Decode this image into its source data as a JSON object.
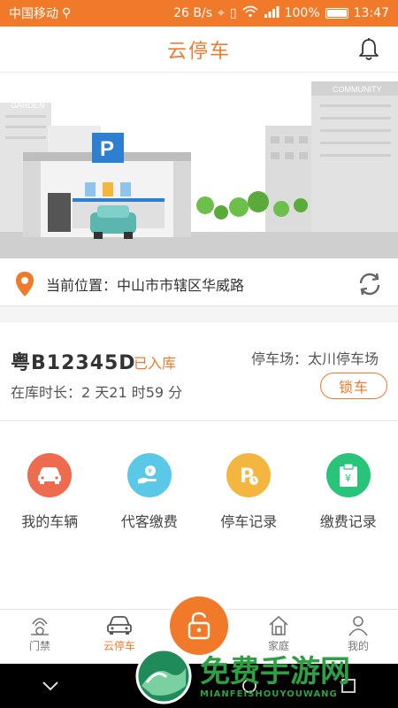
{
  "status_bar": {
    "carrier": "中国移动",
    "net_speed": "26 B/s",
    "battery": "100%",
    "time": "13:47"
  },
  "header": {
    "title": "云停车"
  },
  "banner": {
    "sign_garden": "GARDEN",
    "sign_community": "COMMUNITY",
    "sign_parking": "P"
  },
  "location": {
    "text": "当前位置：中山市市辖区华威路"
  },
  "vehicle": {
    "plate": "粤B12345D",
    "status": "已入库",
    "duration": "在库时长：2 天21 时59 分",
    "lot": "停车场：太川停车场",
    "lock_label": "锁车"
  },
  "features": [
    {
      "label": "我的车辆",
      "color": "#ee6b4f"
    },
    {
      "label": "代客缴费",
      "color": "#5bc8e8"
    },
    {
      "label": "停车记录",
      "color": "#f5b640"
    },
    {
      "label": "缴费记录",
      "color": "#27c47a"
    }
  ],
  "tabs": [
    {
      "label": "门禁"
    },
    {
      "label": "云停车"
    },
    {
      "label": "家庭"
    },
    {
      "label": "我的"
    }
  ],
  "watermark": {
    "main": "免费手游网",
    "sub": "MIANFEISHOUYOUWANG"
  },
  "colors": {
    "accent": "#f07a2a"
  }
}
